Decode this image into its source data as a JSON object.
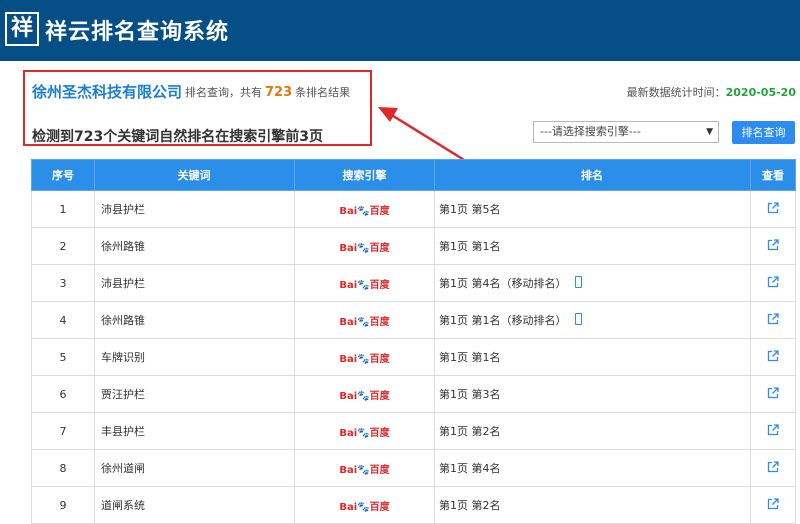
{
  "header": {
    "logo_char": "祥",
    "title": "祥云排名查询系统"
  },
  "company": "徐州圣杰科技有限公司",
  "summary": {
    "prefix": "排名查询，共有",
    "count": "723",
    "suffix": "条排名结果"
  },
  "update": {
    "label": "最新数据统计时间：",
    "date": "2020-05-20"
  },
  "detect_text": "检测到723个关键词自然排名在搜索引擎前3页",
  "engine_select": {
    "value": "---请选择搜索引擎---"
  },
  "query_button": "排名查询",
  "table": {
    "headers": [
      "序号",
      "关键词",
      "搜索引擎",
      "排名",
      "查看"
    ],
    "engine_logo": {
      "part1": "Bai",
      "paw": "🐾",
      "part2": "百度"
    },
    "rows": [
      {
        "idx": "1",
        "keyword": "沛县护栏",
        "rank": "第1页 第5名",
        "mobile": false
      },
      {
        "idx": "2",
        "keyword": "徐州路锥",
        "rank": "第1页 第1名",
        "mobile": false
      },
      {
        "idx": "3",
        "keyword": "沛县护栏",
        "rank": "第1页 第4名（移动排名）",
        "mobile": true
      },
      {
        "idx": "4",
        "keyword": "徐州路锥",
        "rank": "第1页 第1名（移动排名）",
        "mobile": true
      },
      {
        "idx": "5",
        "keyword": "车牌识别",
        "rank": "第1页 第1名",
        "mobile": false
      },
      {
        "idx": "6",
        "keyword": "贾汪护栏",
        "rank": "第1页 第3名",
        "mobile": false
      },
      {
        "idx": "7",
        "keyword": "丰县护栏",
        "rank": "第1页 第2名",
        "mobile": false
      },
      {
        "idx": "8",
        "keyword": "徐州道闸",
        "rank": "第1页 第4名",
        "mobile": false
      },
      {
        "idx": "9",
        "keyword": "道闸系统",
        "rank": "第1页 第2名",
        "mobile": false
      }
    ]
  },
  "colors": {
    "header_bg": "#064f86",
    "table_header": "#2b8ee8",
    "highlight": "#e02828"
  }
}
